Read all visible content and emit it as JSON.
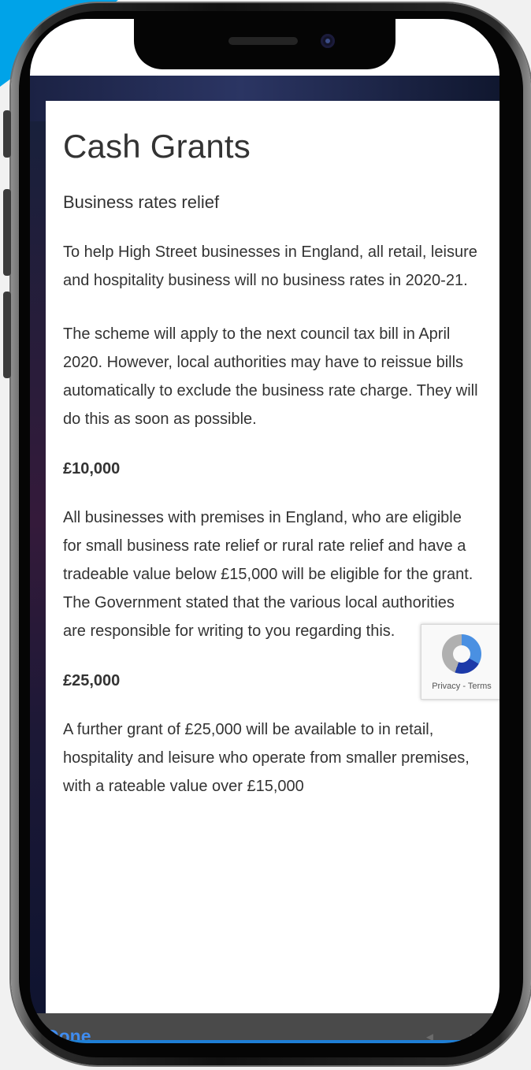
{
  "modal": {
    "title": "Cash Grants",
    "subtitle": "Business rates relief",
    "paragraphs": {
      "intro": "To help High Street businesses in England, all retail, leisure and hospitality business will no business rates in 2020-21.",
      "scheme": "The scheme will apply to the next council tax bill in April 2020. However, local authorities may have to reissue bills automatically to exclude the business rate charge. They will do this as soon as possible.",
      "small_grant": "All businesses with premises in England, who are eligible for small business rate relief or rural rate relief and have a tradeable value below £15,000 will be eligible for the grant. The Government stated that the various local authorities are responsible for writing to you regarding this.",
      "further_grant": "A further grant of £25,000 will be available to in retail, hospitality and leisure who operate from smaller premises, with a rateable value over £15,000"
    },
    "headings": {
      "first": "£10,000",
      "second": "£25,000"
    }
  },
  "recaptcha": {
    "icon": "recaptcha-logo-icon",
    "links": "Privacy - Terms"
  },
  "toolbar": {
    "done_label": "Done",
    "back_icon": "arrow-left-icon",
    "forward_icon": "arrow-right-icon",
    "back_glyph": "◄",
    "forward_glyph": "►"
  },
  "colors": {
    "accent_blue": "#3f8cf0",
    "page_blue": "#00a3e8",
    "toolbar_bg": "#4a4a4a",
    "text": "#333333"
  }
}
